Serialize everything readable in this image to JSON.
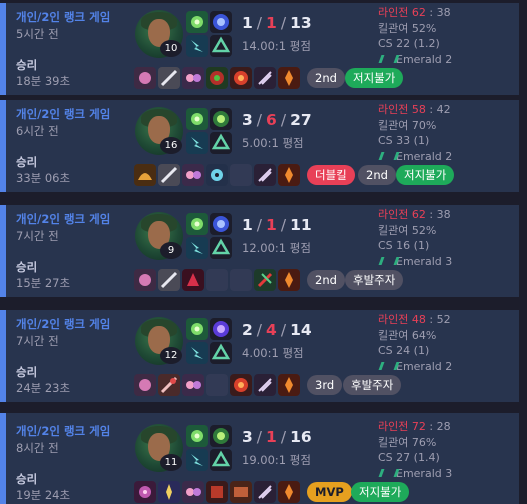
{
  "matches": [
    {
      "queue": "개인/2인 랭크 게임",
      "time_ago": "5시간 전",
      "result": "승리",
      "duration": "18분 39초",
      "level": "10",
      "kda": {
        "k": "1",
        "d": "1",
        "a": "13"
      },
      "kda_ratio": "14.00:1 평점",
      "lane_label": "라인전",
      "lane_score": "62",
      "lane_opp": "38",
      "kill_participation": "킬관여 52%",
      "cs": "CS 22 (1.2)",
      "rank": "Emerald 2",
      "badges": [
        {
          "text": "2nd",
          "style": "gray"
        },
        {
          "text": "저지불가",
          "style": "green"
        }
      ]
    },
    {
      "queue": "개인/2인 랭크 게임",
      "time_ago": "6시간 전",
      "result": "승리",
      "duration": "33분 06초",
      "level": "16",
      "kda": {
        "k": "3",
        "d": "6",
        "a": "27"
      },
      "kda_ratio": "5.00:1 평점",
      "lane_label": "라인전",
      "lane_score": "58",
      "lane_opp": "42",
      "kill_participation": "킬관여 70%",
      "cs": "CS 33 (1)",
      "rank": "Emerald 2",
      "badges": [
        {
          "text": "더블킬",
          "style": "red"
        },
        {
          "text": "2nd",
          "style": "gray"
        },
        {
          "text": "저지불가",
          "style": "green"
        }
      ]
    },
    {
      "queue": "개인/2인 랭크 게임",
      "time_ago": "7시간 전",
      "result": "승리",
      "duration": "15분 27초",
      "level": "9",
      "kda": {
        "k": "1",
        "d": "1",
        "a": "11"
      },
      "kda_ratio": "12.00:1 평점",
      "lane_label": "라인전",
      "lane_score": "62",
      "lane_opp": "38",
      "kill_participation": "킬관여 52%",
      "cs": "CS 16 (1)",
      "rank": "Emerald 3",
      "badges": [
        {
          "text": "2nd",
          "style": "gray"
        },
        {
          "text": "후발주자",
          "style": "gray"
        }
      ]
    },
    {
      "queue": "개인/2인 랭크 게임",
      "time_ago": "7시간 전",
      "result": "승리",
      "duration": "24분 23초",
      "level": "12",
      "kda": {
        "k": "2",
        "d": "4",
        "a": "14"
      },
      "kda_ratio": "4.00:1 평점",
      "lane_label": "라인전",
      "lane_score": "48",
      "lane_opp": "52",
      "kill_participation": "킬관여 64%",
      "cs": "CS 24 (1)",
      "rank": "Emerald 2",
      "badges": [
        {
          "text": "3rd",
          "style": "gray"
        },
        {
          "text": "후발주자",
          "style": "gray"
        }
      ]
    },
    {
      "queue": "개인/2인 랭크 게임",
      "time_ago": "8시간 전",
      "result": "승리",
      "duration": "19분 24초",
      "level": "11",
      "kda": {
        "k": "3",
        "d": "1",
        "a": "16"
      },
      "kda_ratio": "19.00:1 평점",
      "lane_label": "라인전",
      "lane_score": "72",
      "lane_opp": "28",
      "kill_participation": "킬관여 76%",
      "cs": "CS 27 (1.4)",
      "rank": "Emerald 3",
      "badges": [
        {
          "text": "MVP",
          "style": "gold"
        },
        {
          "text": "저지불가",
          "style": "green"
        }
      ]
    }
  ],
  "icons": {
    "summoner_spells": [
      "smite-icon",
      "flash-icon"
    ],
    "runes": [
      "rune-primary-icon",
      "rune-secondary-icon"
    ]
  },
  "colors": {
    "win_accent": "#5383e8",
    "row_bg": "#28344e",
    "deaths": "#e84057",
    "green_badge": "#1eaa5a",
    "mvp_badge": "#e6a01f"
  }
}
